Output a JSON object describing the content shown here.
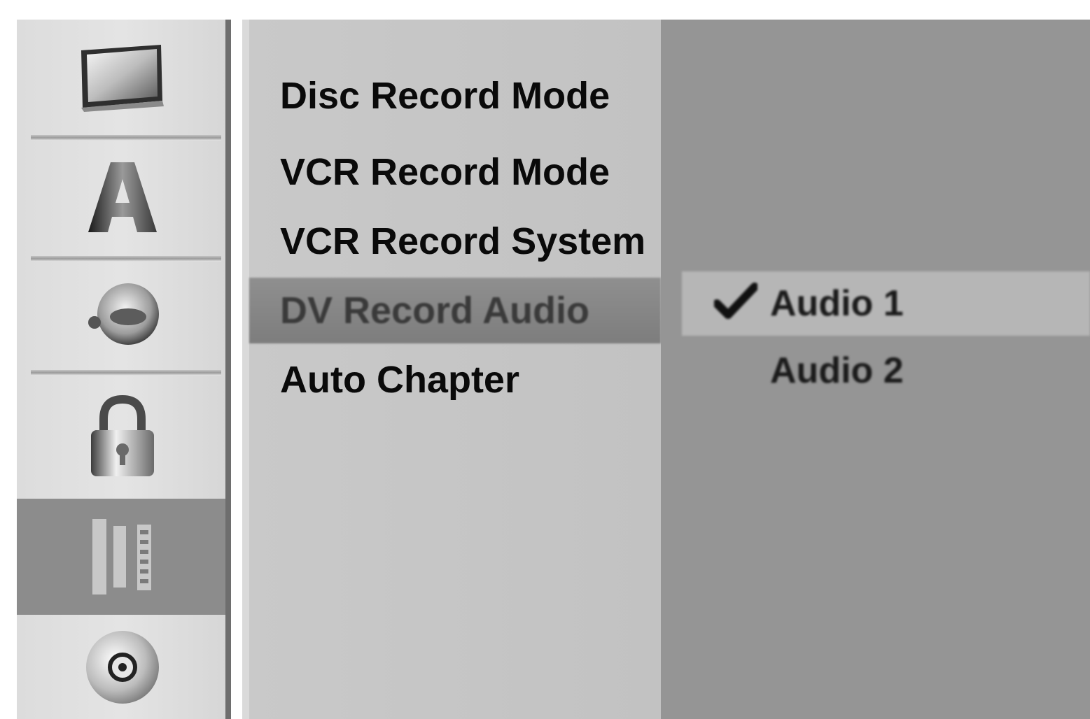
{
  "sidebar": {
    "items": [
      {
        "icon": "tv-icon"
      },
      {
        "icon": "language-a-icon"
      },
      {
        "icon": "audio-speaker-icon"
      },
      {
        "icon": "lock-icon"
      },
      {
        "icon": "recording-film-icon",
        "active": true
      },
      {
        "icon": "disc-icon"
      }
    ]
  },
  "menu": {
    "items": [
      {
        "label": "Disc Record Mode"
      },
      {
        "label": "VCR Record Mode"
      },
      {
        "label": "VCR Record System"
      },
      {
        "label": "DV Record Audio",
        "selected": true
      },
      {
        "label": "Auto Chapter"
      }
    ]
  },
  "options": {
    "items": [
      {
        "label": "Audio 1",
        "checked": true
      },
      {
        "label": "Audio 2",
        "checked": false
      }
    ]
  },
  "colors": {
    "sidebar_bg": "#dcdcdc",
    "active_item_bg": "#8c8c8c",
    "menu_bg": "#c6c6c6",
    "options_bg": "#959595",
    "option_highlight": "#b6b6b6"
  }
}
